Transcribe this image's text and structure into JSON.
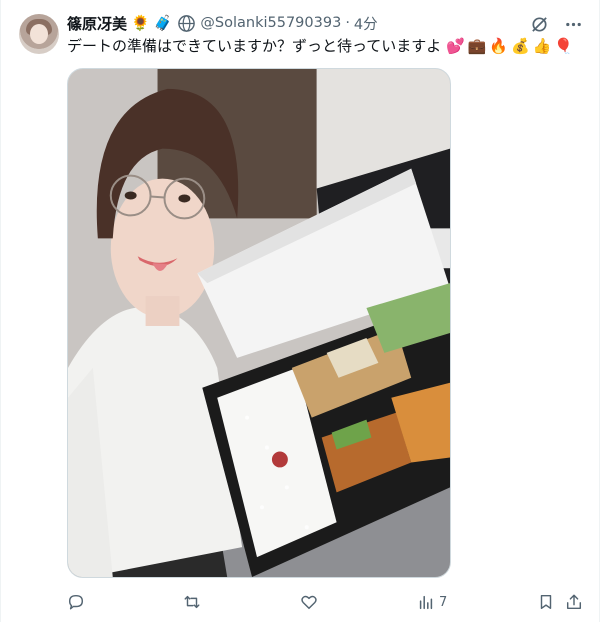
{
  "author": {
    "display_name": "篠原冴美",
    "name_emojis": [
      "🌻",
      "🧳"
    ],
    "globe_icon": "globe-icon",
    "handle": "@Solanki55790393",
    "separator": "·",
    "time": "4分"
  },
  "tweet": {
    "text": "デートの準備はできていますか？ずっと待っていますよ",
    "emojis": "💕💼🔥💰👍🎈"
  },
  "top_actions": {
    "grok_icon": "grok-icon",
    "more_icon": "more-icon"
  },
  "actions": {
    "reply": {
      "icon": "reply-icon",
      "count": ""
    },
    "repost": {
      "icon": "repost-icon",
      "count": ""
    },
    "like": {
      "icon": "heart-icon",
      "count": ""
    },
    "views": {
      "icon": "views-icon",
      "count": "7"
    },
    "bookmark": {
      "icon": "bookmark-icon"
    },
    "share": {
      "icon": "share-icon"
    }
  },
  "colors": {
    "text": "#0f1419",
    "secondary": "#536471",
    "border": "#cfd9de"
  }
}
